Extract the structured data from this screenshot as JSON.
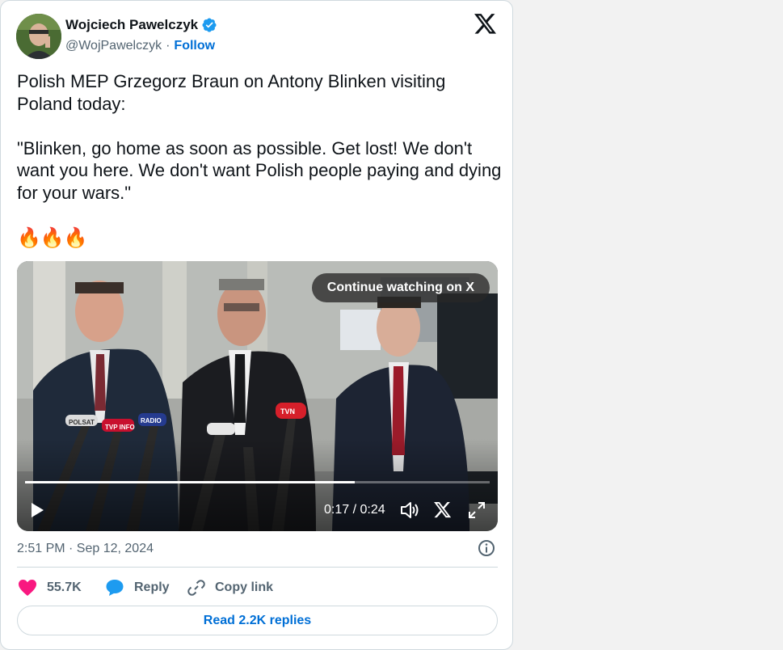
{
  "author": {
    "name": "Wojciech Pawelczyk",
    "handle": "@WojPawelczyk",
    "separator": "·",
    "follow_label": "Follow",
    "verified_icon": "verified-badge-icon"
  },
  "tweet": {
    "text": "Polish MEP Grzegorz Braun on Antony Blinken visiting Poland today:\n\n\"Blinken, go home as soon as possible. Get lost! We don't want you here. We don't want Polish people paying and dying for your wars.\"",
    "emojis": "🔥🔥🔥"
  },
  "video": {
    "continue_label": "Continue watching on X",
    "time": "0:17 / 0:24",
    "progress": 0.71,
    "mic_labels": [
      "POLSAT",
      "TVP INFO",
      "RADIO",
      "TVN"
    ]
  },
  "meta": {
    "timestamp": "2:51 PM · Sep 12, 2024"
  },
  "actions": {
    "likes": "55.7K",
    "reply_label": "Reply",
    "copy_label": "Copy link",
    "read_replies_label": "Read 2.2K replies"
  },
  "colors": {
    "accent": "#006fd6",
    "like": "#f91880",
    "reply": "#1d9bf0",
    "muted": "#536471"
  }
}
